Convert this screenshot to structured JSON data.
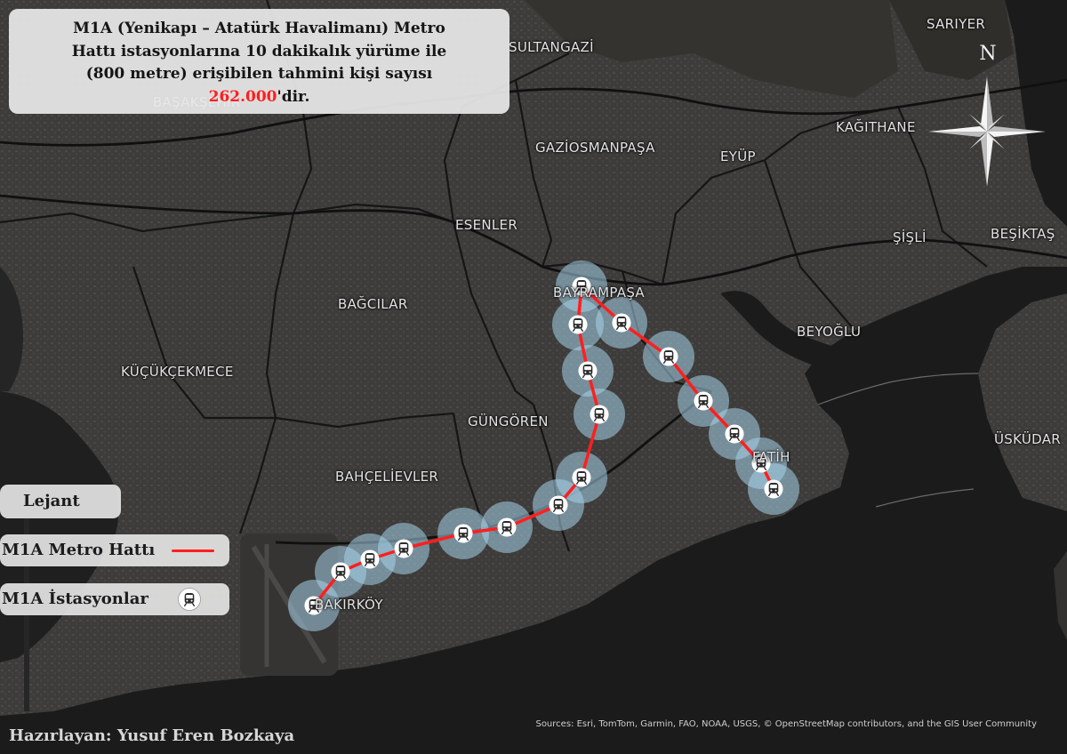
{
  "title": {
    "line1": "M1A (Yenikapı – Atatürk Havalimanı) Metro",
    "line2": "Hattı istasyonlarına 10 dakikalık yürüme ile",
    "line3": "(800 metre) erişibilen tahmini kişi sayısı",
    "highlight_value": "262.000",
    "suffix": "'dir."
  },
  "districts": [
    {
      "id": "sariyer",
      "name": "SARIYER"
    },
    {
      "id": "sultangazi",
      "name": "SULTANGAZİ"
    },
    {
      "id": "basaksehir",
      "name": "BAŞAKŞEHİR"
    },
    {
      "id": "kagithane",
      "name": "KAĞITHANE"
    },
    {
      "id": "gaziosmanpasa",
      "name": "GAZİOSMANPAŞA"
    },
    {
      "id": "eyup",
      "name": "EYÜP"
    },
    {
      "id": "esenler",
      "name": "ESENLER"
    },
    {
      "id": "sisli",
      "name": "ŞİŞLİ"
    },
    {
      "id": "besiktas",
      "name": "BEŞİKTAŞ"
    },
    {
      "id": "bayrampasa",
      "name": "BAYRAMPAŞA"
    },
    {
      "id": "bagcilar",
      "name": "BAĞCILAR"
    },
    {
      "id": "beyoglu",
      "name": "BEYOĞLU"
    },
    {
      "id": "kucukcekmece",
      "name": "KÜÇÜKÇEKMECE"
    },
    {
      "id": "gungoren",
      "name": "GÜNGÖREN"
    },
    {
      "id": "uskudar",
      "name": "ÜSKÜDAR"
    },
    {
      "id": "fatih",
      "name": "FATİH"
    },
    {
      "id": "bahcelievler",
      "name": "BAHÇELİEVLER"
    },
    {
      "id": "bakirkoy",
      "name": "BAKIRKÖY"
    }
  ],
  "legend": {
    "header": "Lejant",
    "line_label": "M1A Metro Hattı",
    "station_label": "M1A İstasyonlar"
  },
  "north_label": "N",
  "sources": "Sources: Esri, TomTom, Garmin, FAO, NOAA, USGS, © OpenStreetMap contributors, and the GIS User Community",
  "author": "Hazırlayan: Yusuf Eren Bozkaya",
  "colors": {
    "land": "#3c3b39",
    "water": "#1b1b1b",
    "line": "#ff1f1f",
    "buffer": "#a6d2ea",
    "title_bg": "#e8e8e8",
    "highlight": "#ff1f1f"
  },
  "icons": {
    "station": "metro-train-icon",
    "north": "compass-rose-icon"
  },
  "stations_count": 18
}
